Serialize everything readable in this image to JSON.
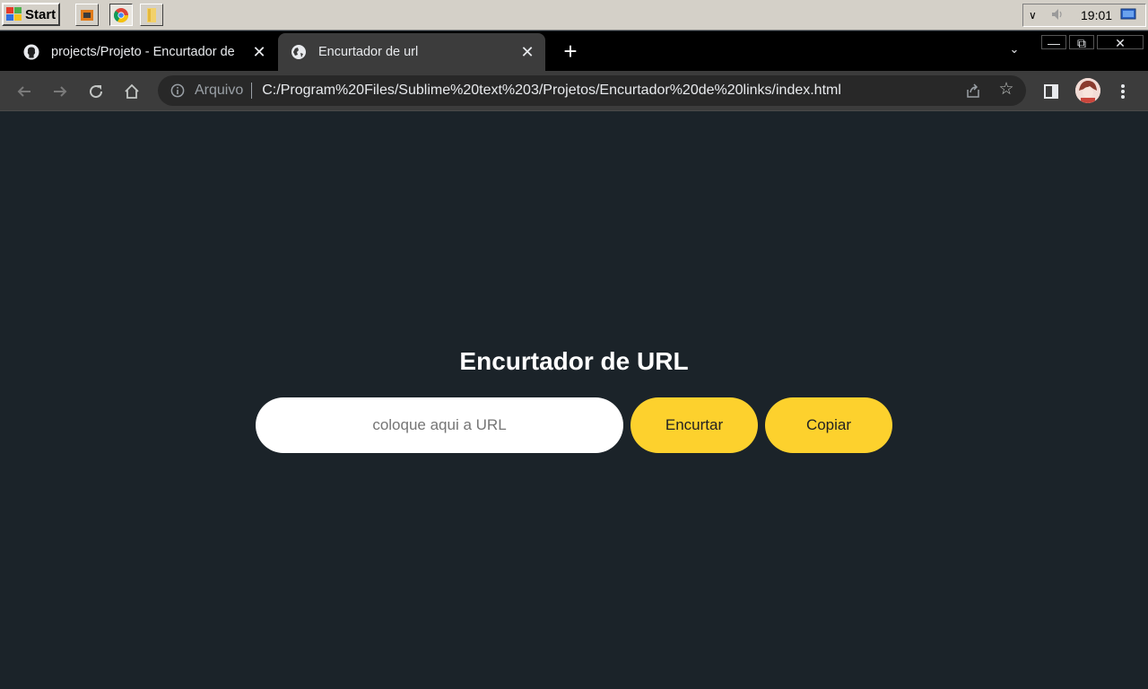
{
  "taskbar": {
    "start_label": "Start",
    "clock": "19:01",
    "quick_launch": [
      "app-icon",
      "chrome-icon",
      "folder-icon"
    ]
  },
  "browser": {
    "tabs": [
      {
        "title": "projects/Projeto - Encurtador de",
        "favicon": "github-icon",
        "active": false
      },
      {
        "title": "Encurtador de url",
        "favicon": "globe-icon",
        "active": true
      }
    ],
    "omnibox": {
      "scheme_label": "Arquivo",
      "url": "C:/Program%20Files/Sublime%20text%203/Projetos/Encurtador%20de%20links/index.html"
    }
  },
  "page": {
    "heading": "Encurtador de URL",
    "input": {
      "placeholder": "coloque aqui a URL",
      "value": ""
    },
    "shorten_label": "Encurtar",
    "copy_label": "Copiar"
  },
  "colors": {
    "page_background": "#1b2329",
    "button_accent": "#fdd12d",
    "input_background": "#ffffff"
  }
}
